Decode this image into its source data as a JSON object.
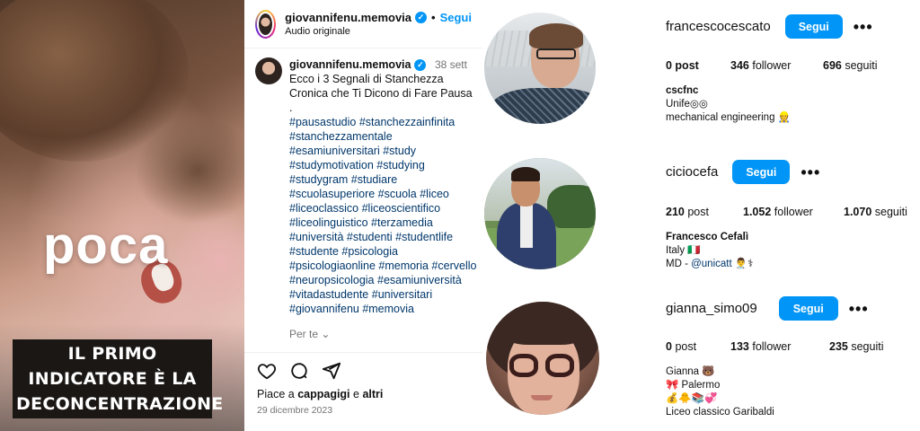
{
  "video": {
    "big_word": "poca",
    "caption_line1": "IL PRIMO INDICATORE È LA",
    "caption_line2": "DECONCENTRAZIONE"
  },
  "post": {
    "header_username": "giovannifenu.memovia",
    "follow_label": "Segui",
    "audio_label": "Audio originale",
    "comment_username": "giovannifenu.memovia",
    "comment_time": "38 sett",
    "comment_lines": [
      "Ecco i 3 Segnali di Stanchezza",
      "Cronica che Ti Dicono di Fare Pausa",
      "."
    ],
    "hashtag_lines": [
      "#pausastudio #stanchezzainfinita",
      "#stanchezzamentale",
      "#esamiuniversitari #study",
      "#studymotivation #studying",
      "#studygram #studiare",
      "#scuolasuperiore #scuola #liceo",
      "#liceoclassico #liceoscientifico",
      "#liceolinguistico #terzamedia",
      "#università #studenti #studentlife",
      "#studente #psicologia",
      "#psicologiaonline #memoria #cervello",
      "#neuropsicologia #esamiuniversità",
      "#vitadastudente #universitari",
      "#giovannifenu #memovia"
    ],
    "see_more": "Per te",
    "likes_prefix": "Piace a",
    "likes_user": "cappagigi",
    "likes_and": "e",
    "likes_others": "altri",
    "date": "29 dicembre 2023"
  },
  "profiles": [
    {
      "username": "francescocescato",
      "follow_label": "Segui",
      "posts": "0 post",
      "followers_num": "346",
      "followers_label": "follower",
      "following_num": "696",
      "following_label": "seguiti",
      "bio_name": "cscfnc",
      "bio_lines": [
        "Unife◎◎",
        "mechanical engineering 👷"
      ]
    },
    {
      "username": "ciciocefa",
      "follow_label": "Segui",
      "posts_num": "210",
      "posts_label": "post",
      "followers_num": "1.052",
      "followers_label": "follower",
      "following_num": "1.070",
      "following_label": "seguiti",
      "bio_name": "Francesco Cefalì",
      "bio_lines": [
        "Italy 🇮🇹",
        "MD - "
      ],
      "bio_link": "@unicatt",
      "bio_link_suffix": " 👨‍⚕️⚕"
    },
    {
      "username": "gianna_simo09",
      "follow_label": "Segui",
      "posts_num": "0",
      "posts_label": "post",
      "followers_num": "133",
      "followers_label": "follower",
      "following_num": "235",
      "following_label": "seguiti",
      "bio_name": "Gianna 🐻",
      "bio_lines": [
        "🎀 Palermo",
        "💰🐥📚💞",
        "Liceo classico Garibaldi"
      ]
    }
  ],
  "colors": {
    "accent": "#0095f6",
    "link": "#00376b",
    "muted": "#737373"
  }
}
